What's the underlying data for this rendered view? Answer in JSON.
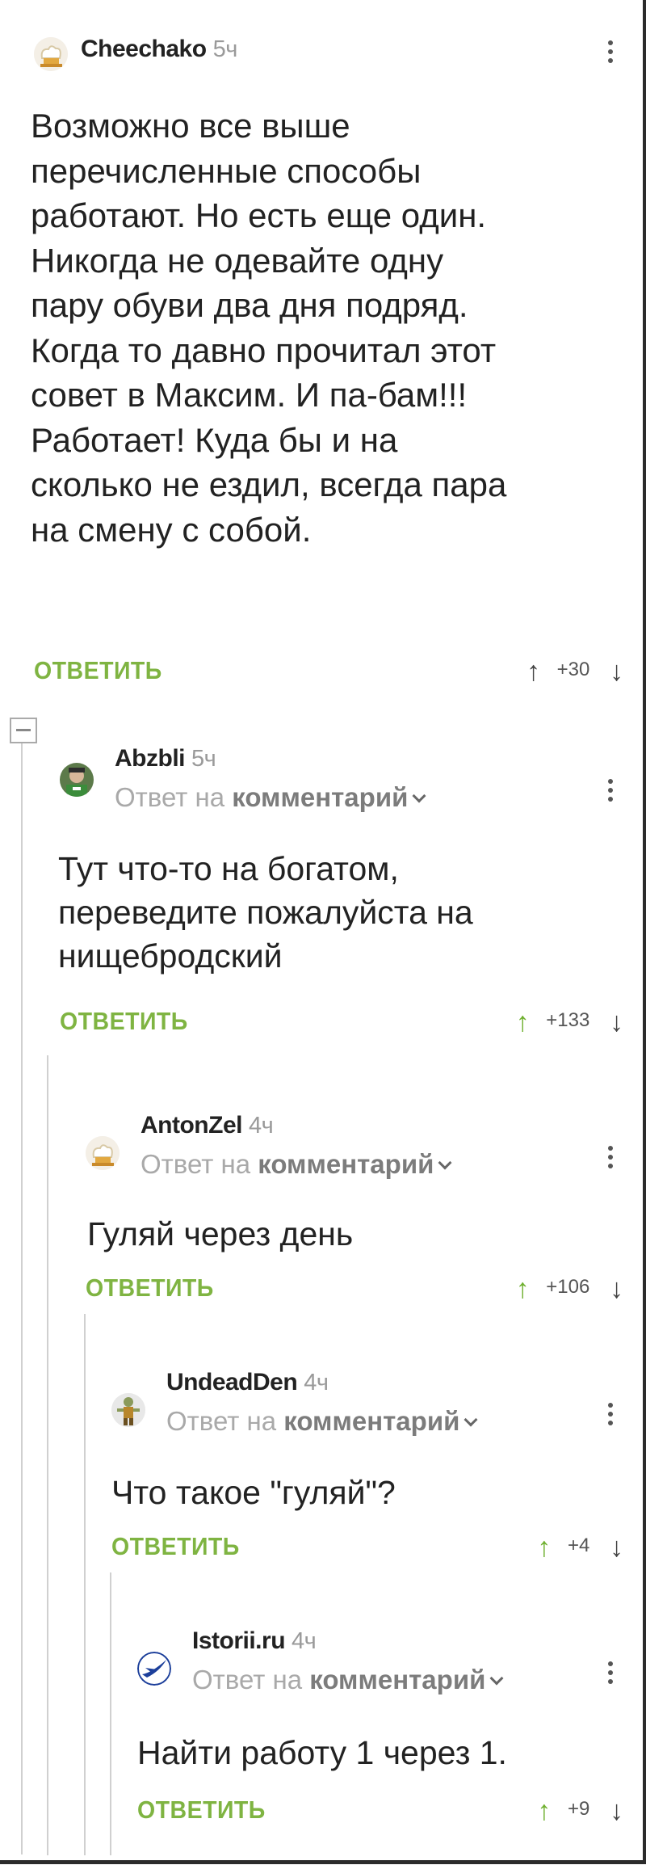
{
  "comments": [
    {
      "author": "Cheechako",
      "time": "5ч",
      "avatar_icon": "chef-hat-avatar",
      "text_lines": [
        "Возможно все выше",
        "перечисленные способы",
        "работают. Но есть еще один.",
        "Никогда не одевайте одну",
        "пару обуви два дня подряд.",
        "Когда то давно прочитал этот",
        "совет в Максим. И па-бам!!!",
        "Работает! Куда бы и на",
        "сколько не ездил, всегда пара",
        "на смену с собой."
      ],
      "reply_label": "ОТВЕТИТЬ",
      "rating": "+30",
      "upvoted": false
    },
    {
      "author": "Abzbli",
      "time": "5ч",
      "avatar_icon": "person-photo-avatar",
      "reply_to_prefix": "Ответ на",
      "reply_to_target": "комментарий",
      "text_lines": [
        "Тут что-то на богатом,",
        "переведите пожалуйста на",
        "нищебродский"
      ],
      "reply_label": "ОТВЕТИТЬ",
      "rating": "+133",
      "upvoted": true
    },
    {
      "author": "AntonZel",
      "time": "4ч",
      "avatar_icon": "chef-hat-avatar",
      "reply_to_prefix": "Ответ на",
      "reply_to_target": "комментарий",
      "text_lines": [
        "Гуляй через день"
      ],
      "reply_label": "ОТВЕТИТЬ",
      "rating": "+106",
      "upvoted": true
    },
    {
      "author": "UndeadDen",
      "time": "4ч",
      "avatar_icon": "zombie-figure-avatar",
      "reply_to_prefix": "Ответ на",
      "reply_to_target": "комментарий",
      "text_lines": [
        "Что такое \"гуляй\"?"
      ],
      "reply_label": "ОТВЕТИТЬ",
      "rating": "+4",
      "upvoted": true
    },
    {
      "author": "Istorii.ru",
      "time": "4ч",
      "avatar_icon": "blue-plane-logo-avatar",
      "reply_to_prefix": "Ответ на",
      "reply_to_target": "комментарий",
      "text_lines": [
        "Найти работу 1 через 1."
      ],
      "reply_label": "ОТВЕТИТЬ",
      "rating": "+9",
      "upvoted": true
    }
  ],
  "icons": {
    "upvote": "↑",
    "downvote": "↓",
    "more": "kebab-menu-icon",
    "collapse": "collapse-thread-icon"
  },
  "colors": {
    "reply_green": "#7fb442",
    "upvote_green": "#6fb02f",
    "muted": "#9a9a9a"
  }
}
